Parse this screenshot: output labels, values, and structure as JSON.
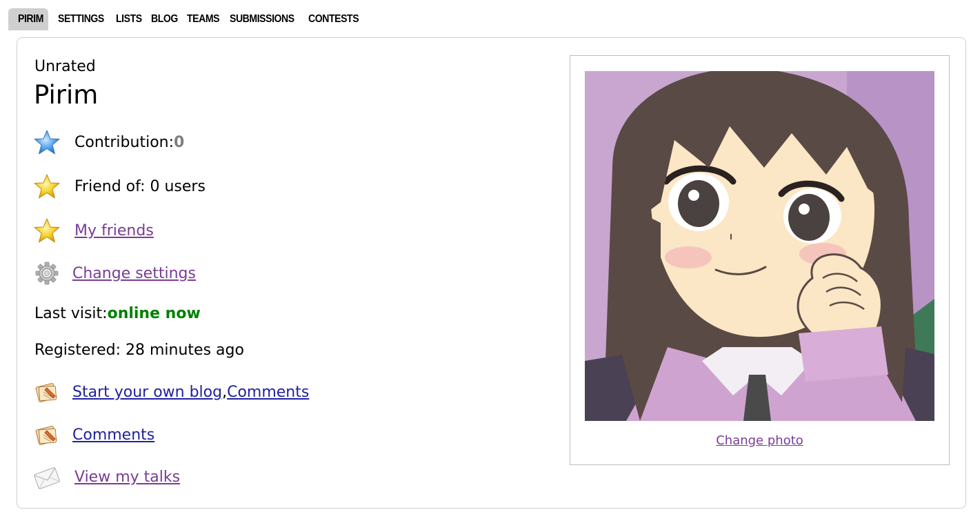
{
  "nav": {
    "tabs": [
      "PIRIM",
      "SETTINGS",
      "LISTS",
      "BLOG",
      "TEAMS",
      "SUBMISSIONS",
      "CONTESTS"
    ],
    "active": "PIRIM"
  },
  "profile": {
    "rank": "Unrated",
    "handle": "Pirim",
    "contribution_label": "Contribution: ",
    "contribution_value": "0",
    "friend_of": "Friend of: 0 users",
    "my_friends": "My friends",
    "change_settings": "Change settings",
    "last_visit_label": "Last visit: ",
    "last_visit_value": "online now",
    "registered": "Registered: 28 minutes ago",
    "blog_link": "Start your own blog",
    "blog_sep": ", ",
    "comments_link": "Comments",
    "comments_link_2": "Comments",
    "talks_link": "View my talks",
    "change_photo": "Change photo"
  },
  "icons": {
    "contribution": "blue-star-icon",
    "friend_of": "gold-star-icon",
    "my_friends": "gold-star-icon",
    "settings": "gear-icon",
    "blog": "blog-icon",
    "comments": "blog-icon",
    "talks": "envelope-icon"
  },
  "colors": {
    "link_visited": "#7a3b96",
    "link": "#2020a0",
    "online": "#008000",
    "contribution_zero": "#808080",
    "active_tab": "#cfcfcf"
  }
}
